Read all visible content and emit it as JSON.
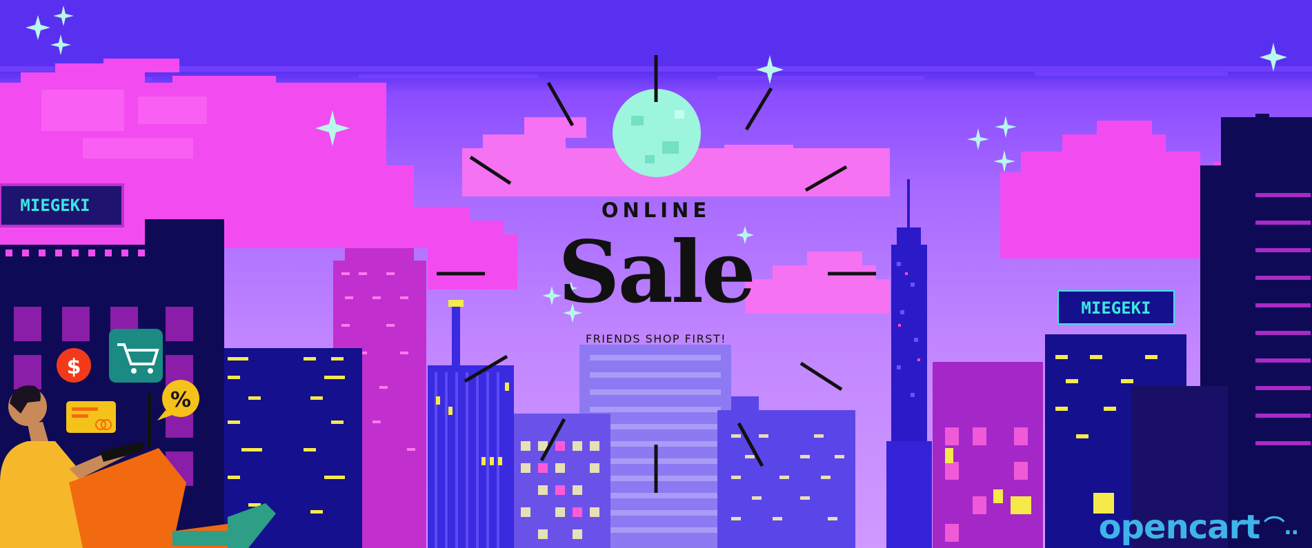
{
  "banner": {
    "headline_top": "ONLINE",
    "headline_main": "Sale",
    "tagline": "FRIENDS SHOP FIRST!",
    "brand_logo": "opencart",
    "brand_cart_glyph": "⌒..",
    "sign_text": "MIEGEKI",
    "icons": [
      "sparkle-icon",
      "moon-icon",
      "dollar-icon",
      "shopping-cart-icon",
      "percent-icon",
      "credit-card-icon",
      "laptop-icon"
    ]
  },
  "colors": {
    "sky": "#5a30f0",
    "sky_band": "#8a4cff",
    "cloud_pink": "#f24cf0",
    "horizon": "#c184ff",
    "moon": "#9df5dd",
    "sparkle": "#b8f7ec",
    "brand": "#3fb4e8"
  }
}
